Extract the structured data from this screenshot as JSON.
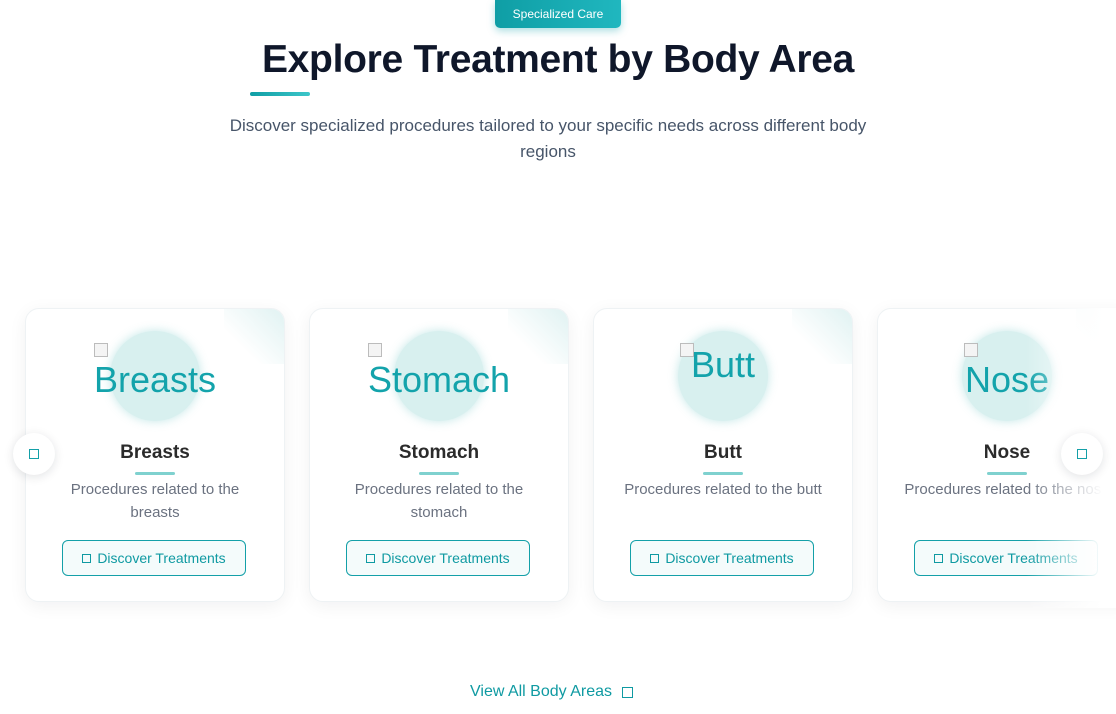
{
  "header": {
    "badge": "Specialized Care",
    "title": "Explore Treatment by Body Area",
    "subtitle": "Discover specialized procedures tailored to your specific needs across different body regions"
  },
  "cards": [
    {
      "image_alt": "Breasts",
      "name": "Breasts",
      "description": "Procedures related to the breasts",
      "button": "Discover Treatments"
    },
    {
      "image_alt": "Stomach",
      "name": "Stomach",
      "description": "Procedures related to the stomach",
      "button": "Discover Treatments"
    },
    {
      "image_alt": "Butt",
      "name": "Butt",
      "description": "Procedures related to the butt",
      "button": "Discover Treatments"
    },
    {
      "image_alt": "Nose",
      "name": "Nose",
      "description": "Procedures related to the nose",
      "button": "Discover Treatments"
    }
  ],
  "carousel": {
    "prev_icon": "square-icon",
    "next_icon": "square-icon"
  },
  "footer": {
    "view_all": "View All Body Areas",
    "view_all_icon": "square-icon"
  },
  "colors": {
    "accent": "#14a0a8",
    "title": "#0f172a",
    "text": "#6b7280"
  }
}
